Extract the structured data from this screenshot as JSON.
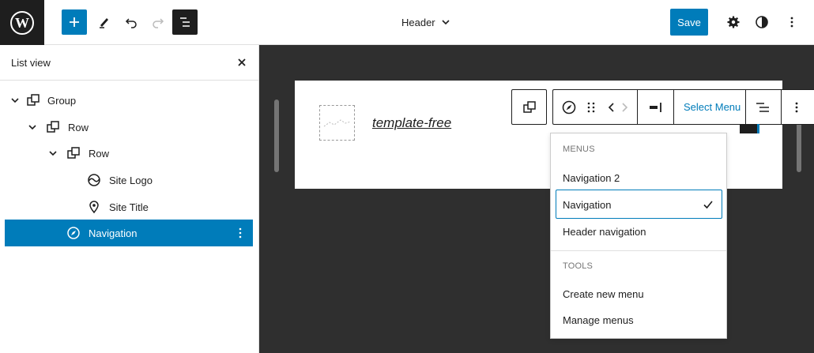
{
  "topbar": {
    "document_title": "Header",
    "save_label": "Save"
  },
  "sidebar": {
    "title": "List view",
    "tree": [
      {
        "label": "Group",
        "expanded": true,
        "icon": "group-block-icon"
      },
      {
        "label": "Row",
        "expanded": true,
        "icon": "row-block-icon"
      },
      {
        "label": "Row",
        "expanded": true,
        "icon": "row-block-icon"
      },
      {
        "label": "Site Logo",
        "icon": "site-logo-icon"
      },
      {
        "label": "Site Title",
        "icon": "site-title-icon"
      },
      {
        "label": "Navigation",
        "icon": "navigation-compass-icon",
        "selected": true
      }
    ]
  },
  "canvas": {
    "site_title": "template-free",
    "toolbar": {
      "select_menu_label": "Select Menu"
    },
    "dropdown": {
      "menus_heading": "Menus",
      "menus": [
        "Navigation 2",
        "Navigation",
        "Header navigation"
      ],
      "selected_menu": "Navigation",
      "tools_heading": "Tools",
      "tools": [
        "Create new menu",
        "Manage menus"
      ]
    }
  },
  "colors": {
    "accent": "#007cba",
    "dark": "#1e1e1e",
    "canvas_bg": "#2f2f2f"
  }
}
